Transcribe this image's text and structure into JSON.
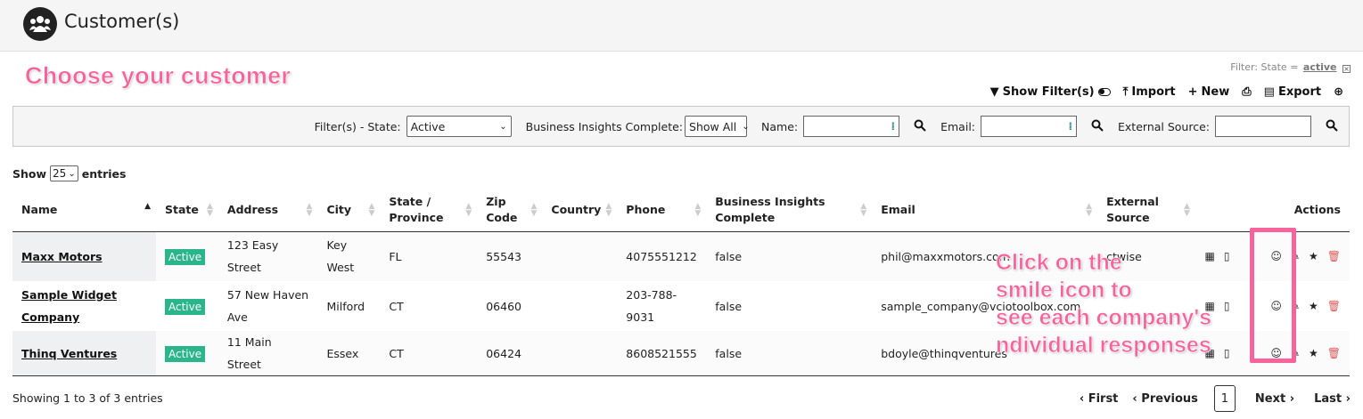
{
  "header": {
    "title": "Customer(s)",
    "logo_icon": "people-group-icon"
  },
  "callouts": {
    "top": "Choose your customer",
    "right": [
      "Click on the",
      "smile icon to",
      "see each company's",
      "ndividual responses"
    ],
    "color": "#f7639a"
  },
  "filter_summary": {
    "label": "Filter: State =",
    "value": "active"
  },
  "toolbar": {
    "show_filters": "Show Filter(s)",
    "import": "Import",
    "new": "New",
    "export": "Export"
  },
  "filters": {
    "state_label": "Filter(s) - State:",
    "state_value": "Active",
    "bi_label": "Business Insights Complete:",
    "bi_value": "Show All",
    "name_label": "Name:",
    "email_label": "Email:",
    "external_label": "External Source:"
  },
  "entries": {
    "show": "Show",
    "count": "25",
    "suffix": "entries"
  },
  "table": {
    "columns": [
      "Name",
      "State",
      "Address",
      "City",
      "State / Province",
      "Zip Code",
      "Country",
      "Phone",
      "Business Insights Complete",
      "Email",
      "External Source",
      "Actions"
    ],
    "rows": [
      {
        "name": "Maxx Motors",
        "state": "Active",
        "address": "123 Easy Street",
        "city": "Key West",
        "province": "FL",
        "zip": "55543",
        "country": "",
        "phone": "4075551212",
        "bi": "false",
        "email": "phil@maxxmotors.com",
        "external": "ctwise"
      },
      {
        "name": "Sample Widget Company",
        "state": "Active",
        "address": "57 New Haven Ave",
        "city": "Milford",
        "province": "CT",
        "zip": "06460",
        "country": "",
        "phone": "203-788-9031",
        "bi": "false",
        "email": "sample_company@vciotoolbox.com",
        "external": ""
      },
      {
        "name": "Thinq Ventures",
        "state": "Active",
        "address": "11 Main Street",
        "city": "Essex",
        "province": "CT",
        "zip": "06424",
        "country": "",
        "phone": "8608521555",
        "bi": "false",
        "email": "bdoyle@thinqventures",
        "external": ""
      }
    ],
    "status_color": "#2bb58a"
  },
  "footer": {
    "info": "Showing 1 to 3 of 3 entries",
    "first": "‹ First",
    "previous": "‹ Previous",
    "page": "1",
    "next": "Next ›",
    "last": "Last ›"
  }
}
